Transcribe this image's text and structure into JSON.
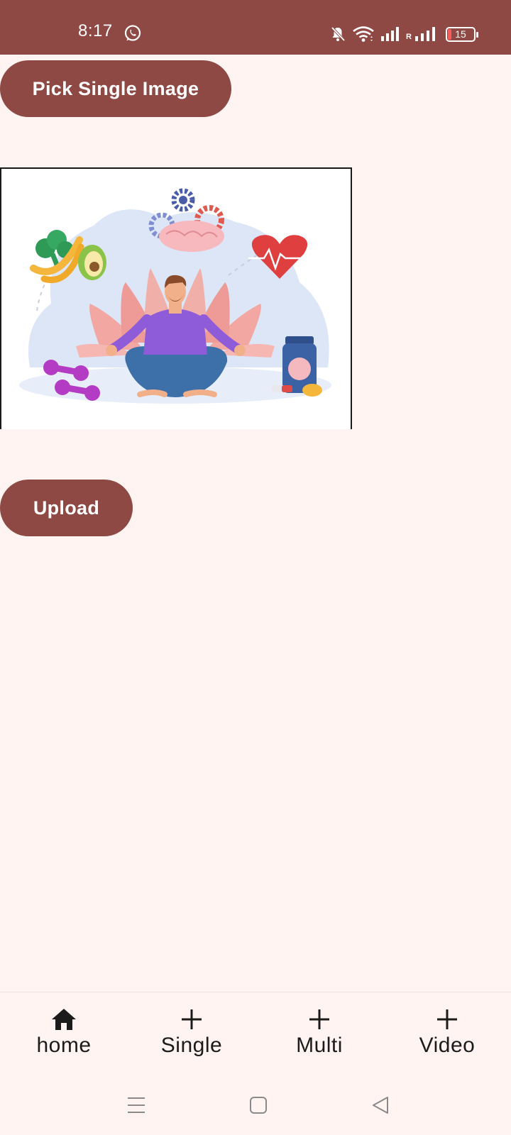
{
  "status_bar": {
    "time": "8:17",
    "battery_level": "15",
    "signal_label": "R"
  },
  "main": {
    "pick_button_label": "Pick Single Image",
    "upload_button_label": "Upload"
  },
  "bottom_nav": {
    "items": [
      {
        "label": "home",
        "icon": "home-icon"
      },
      {
        "label": "Single",
        "icon": "plus-icon"
      },
      {
        "label": "Multi",
        "icon": "plus-icon"
      },
      {
        "label": "Video",
        "icon": "plus-icon"
      }
    ]
  },
  "colors": {
    "primary": "#8F4944",
    "background": "#FFF4F2"
  }
}
